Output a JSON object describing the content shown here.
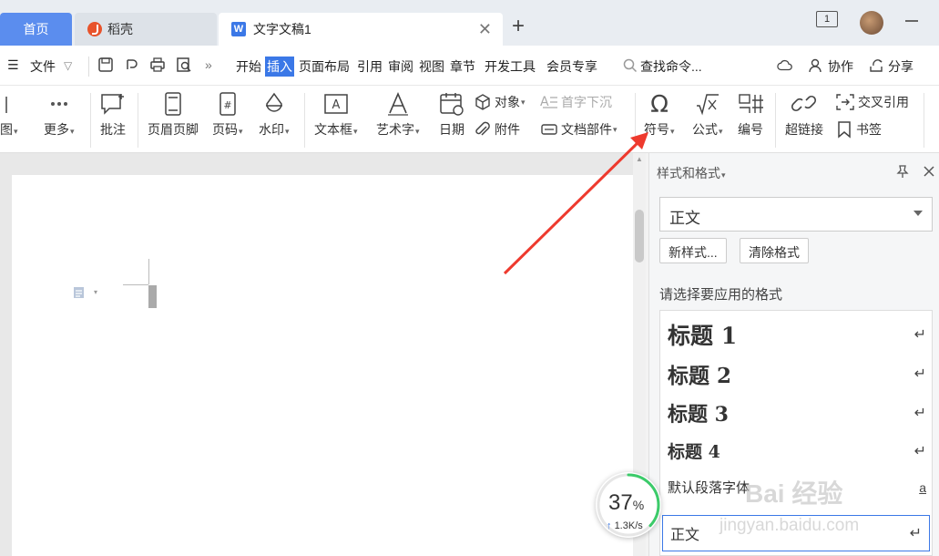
{
  "tabs": {
    "home": "首页",
    "docer": "稻壳",
    "document": "文字文稿1"
  },
  "window": {
    "badge": "1"
  },
  "menu": {
    "file": "文件",
    "items": [
      "开始",
      "插入",
      "页面布局",
      "引用",
      "审阅",
      "视图",
      "章节",
      "开发工具",
      "会员专享"
    ],
    "active": "插入",
    "search_placeholder": "查找命令...",
    "collab": "协作",
    "share": "分享"
  },
  "ribbon": {
    "partial": "图",
    "more": "更多",
    "comment": "批注",
    "header_footer": "页眉页脚",
    "page_number": "页码",
    "watermark": "水印",
    "textbox": "文本框",
    "wordart": "艺术字",
    "date": "日期",
    "object": "对象",
    "attachment": "附件",
    "drop_cap": "首字下沉",
    "doc_parts": "文档部件",
    "symbol": "符号",
    "formula": "公式",
    "numbering": "编号",
    "hyperlink": "超链接",
    "cross_ref": "交叉引用",
    "bookmark": "书签"
  },
  "panel": {
    "title": "样式和格式",
    "current_style": "正文",
    "new_style": "新样式...",
    "clear_format": "清除格式",
    "apply_label": "请选择要应用的格式",
    "styles": [
      {
        "name": "标题 1",
        "mark": "↵"
      },
      {
        "name": "标题 2",
        "mark": "↵"
      },
      {
        "name": "标题 3",
        "mark": "↵"
      },
      {
        "name": "标题 4",
        "mark": "↵"
      },
      {
        "name": "默认段落字体",
        "mark": "a"
      },
      {
        "name": "正文",
        "mark": "↵"
      }
    ]
  },
  "speed": {
    "percent": "37",
    "unit": "%",
    "rate": "1.3K/s",
    "progress": 0.37
  },
  "watermark": {
    "brand": "Bai 经验",
    "url": "jingyan.baidu.com"
  },
  "colors": {
    "accent": "#3b78e7",
    "home_tab": "#5b8dee",
    "arrow": "#ee3a2e",
    "speed_ring": "#3ccb6a"
  }
}
